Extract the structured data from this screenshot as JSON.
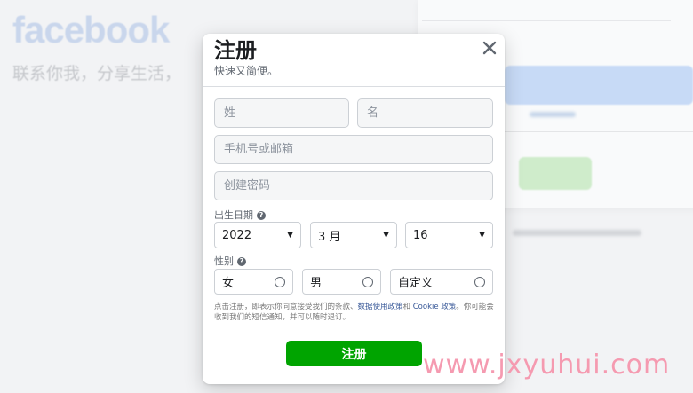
{
  "background": {
    "logo": "facebook",
    "tagline": "联系你我，分享生活，"
  },
  "signup_modal": {
    "title": "注册",
    "subtitle": "快速又简便。",
    "close_icon": "close-icon",
    "last_name_placeholder": "姓",
    "first_name_placeholder": "名",
    "contact_placeholder": "手机号或邮箱",
    "password_placeholder": "创建密码",
    "birthday": {
      "label": "出生日期",
      "year": "2022",
      "month": "3 月",
      "day": "16"
    },
    "gender": {
      "label": "性别",
      "options": [
        "女",
        "男",
        "自定义"
      ]
    },
    "terms": {
      "prefix": "点击注册，即表示你同意接受我们的条款、",
      "data_policy_link": "数据使用政策",
      "and": "和 ",
      "cookie_policy_link": "Cookie 政策",
      "suffix": "。你可能会收到我们的短信通知，并可以随时退订。"
    },
    "submit_label": "注册"
  },
  "watermark": "www.jxyuhui.com",
  "colors": {
    "primary_green": "#00a400",
    "link_blue": "#385898",
    "logo_blue_faded": "#c9d6ec"
  }
}
